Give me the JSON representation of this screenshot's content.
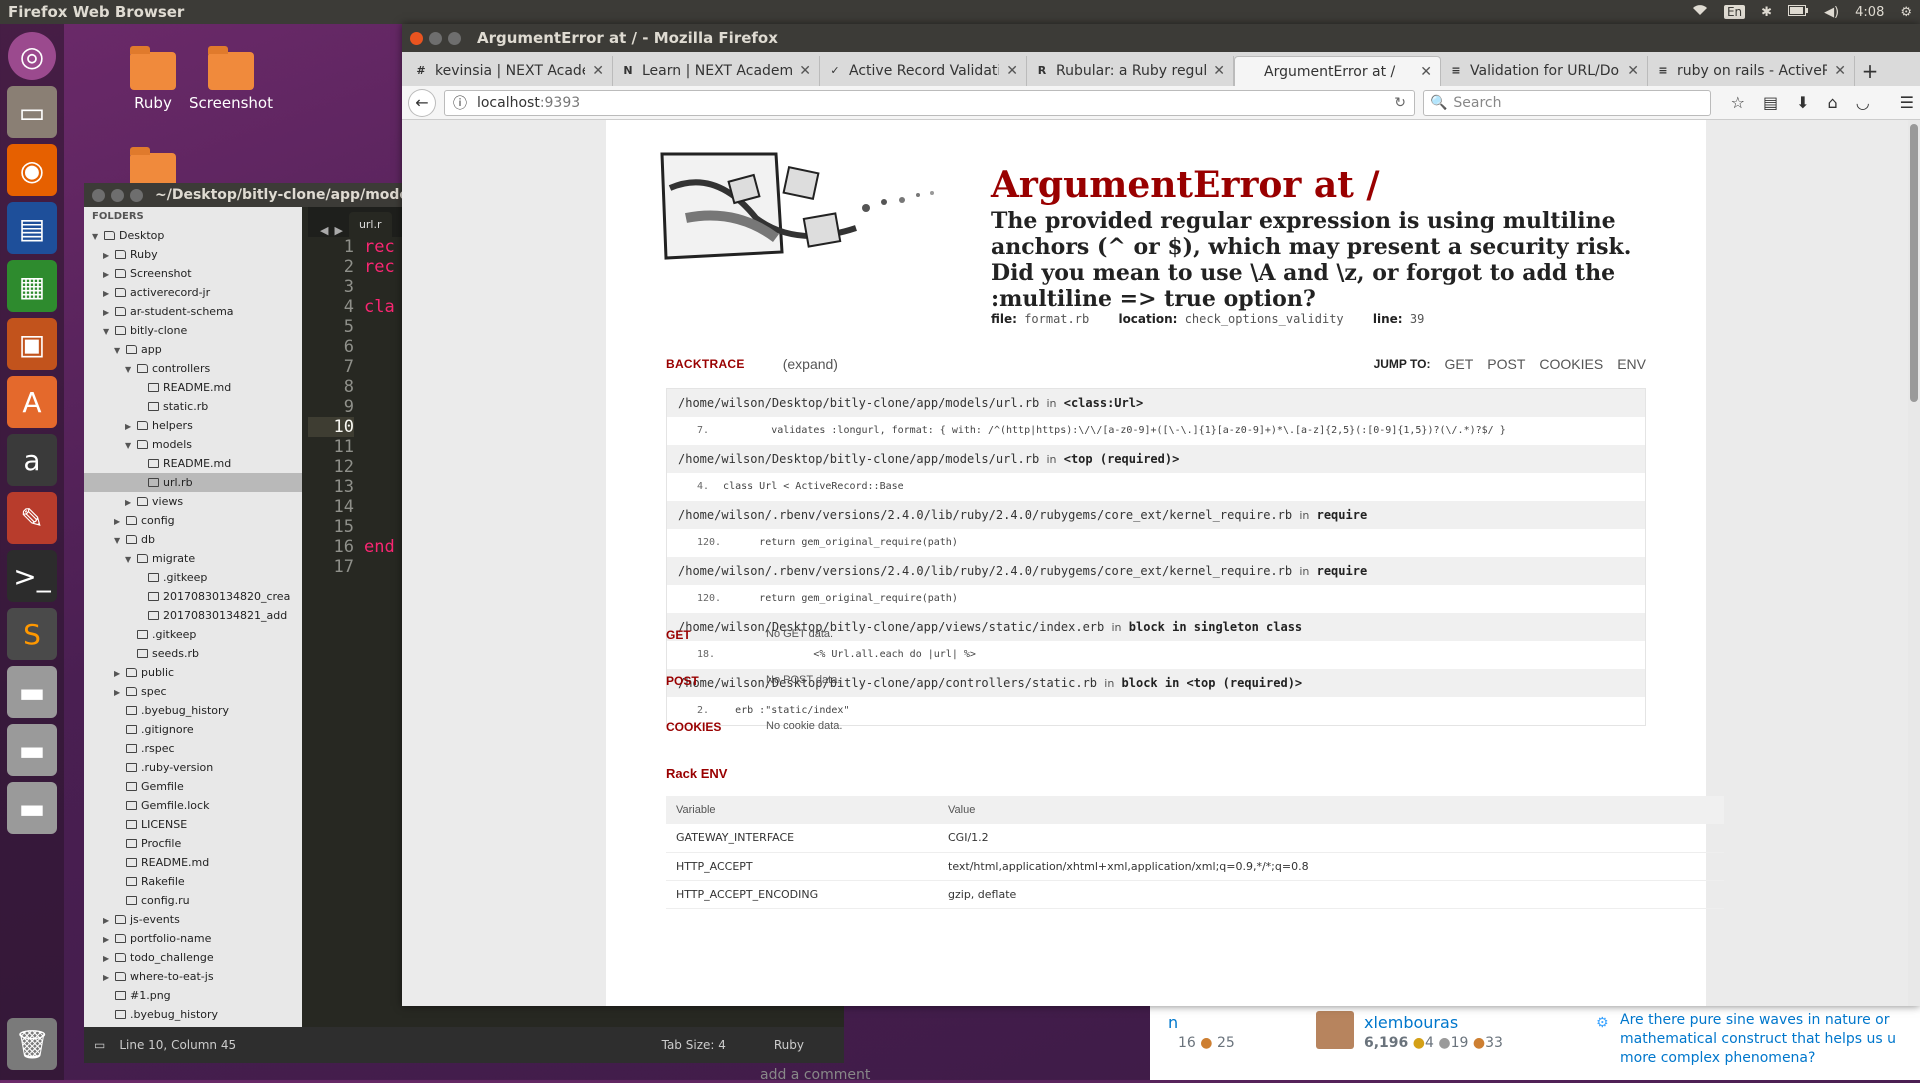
{
  "top_panel": {
    "title": "Firefox Web Browser",
    "keyboard": "En",
    "clock": "4:08"
  },
  "desktop": {
    "icons": [
      {
        "label": "Ruby"
      },
      {
        "label": "Screenshot"
      }
    ]
  },
  "sublime": {
    "title": "~/Desktop/bitly-clone/app/mode",
    "sidebar_header": "FOLDERS",
    "tree": [
      {
        "label": "Desktop",
        "type": "folder",
        "open": true,
        "depth": 0
      },
      {
        "label": "Ruby",
        "type": "folder",
        "open": false,
        "depth": 1
      },
      {
        "label": "Screenshot",
        "type": "folder",
        "open": false,
        "depth": 1
      },
      {
        "label": "activerecord-jr",
        "type": "folder",
        "open": false,
        "depth": 1
      },
      {
        "label": "ar-student-schema",
        "type": "folder",
        "open": false,
        "depth": 1
      },
      {
        "label": "bitly-clone",
        "type": "folder",
        "open": true,
        "depth": 1
      },
      {
        "label": "app",
        "type": "folder",
        "open": true,
        "depth": 2
      },
      {
        "label": "controllers",
        "type": "folder",
        "open": true,
        "depth": 3
      },
      {
        "label": "README.md",
        "type": "file",
        "depth": 4
      },
      {
        "label": "static.rb",
        "type": "file",
        "depth": 4
      },
      {
        "label": "helpers",
        "type": "folder",
        "open": false,
        "depth": 3
      },
      {
        "label": "models",
        "type": "folder",
        "open": true,
        "depth": 3
      },
      {
        "label": "README.md",
        "type": "file",
        "depth": 4
      },
      {
        "label": "url.rb",
        "type": "file",
        "depth": 4,
        "selected": true
      },
      {
        "label": "views",
        "type": "folder",
        "open": false,
        "depth": 3
      },
      {
        "label": "config",
        "type": "folder",
        "open": false,
        "depth": 2
      },
      {
        "label": "db",
        "type": "folder",
        "open": true,
        "depth": 2
      },
      {
        "label": "migrate",
        "type": "folder",
        "open": true,
        "depth": 3
      },
      {
        "label": ".gitkeep",
        "type": "file",
        "depth": 4
      },
      {
        "label": "20170830134820_crea",
        "type": "file",
        "depth": 4
      },
      {
        "label": "20170830134821_add",
        "type": "file",
        "depth": 4
      },
      {
        "label": ".gitkeep",
        "type": "file",
        "depth": 3
      },
      {
        "label": "seeds.rb",
        "type": "file",
        "depth": 3
      },
      {
        "label": "public",
        "type": "folder",
        "open": false,
        "depth": 2
      },
      {
        "label": "spec",
        "type": "folder",
        "open": false,
        "depth": 2
      },
      {
        "label": ".byebug_history",
        "type": "file",
        "depth": 2
      },
      {
        "label": ".gitignore",
        "type": "file",
        "depth": 2
      },
      {
        "label": ".rspec",
        "type": "file",
        "depth": 2
      },
      {
        "label": ".ruby-version",
        "type": "file",
        "depth": 2
      },
      {
        "label": "Gemfile",
        "type": "file",
        "depth": 2
      },
      {
        "label": "Gemfile.lock",
        "type": "file",
        "depth": 2
      },
      {
        "label": "LICENSE",
        "type": "file",
        "depth": 2
      },
      {
        "label": "Procfile",
        "type": "file",
        "depth": 2
      },
      {
        "label": "README.md",
        "type": "file",
        "depth": 2
      },
      {
        "label": "Rakefile",
        "type": "file",
        "depth": 2
      },
      {
        "label": "config.ru",
        "type": "file",
        "depth": 2
      },
      {
        "label": "js-events",
        "type": "folder",
        "open": false,
        "depth": 1
      },
      {
        "label": "portfolio-name",
        "type": "folder",
        "open": false,
        "depth": 1
      },
      {
        "label": "todo_challenge",
        "type": "folder",
        "open": false,
        "depth": 1
      },
      {
        "label": "where-to-eat-js",
        "type": "folder",
        "open": false,
        "depth": 1
      },
      {
        "label": "#1.png",
        "type": "image",
        "depth": 1
      },
      {
        "label": ".byebug_history",
        "type": "file",
        "depth": 1
      }
    ],
    "editor_tab": "url.r",
    "line_numbers": [
      "1",
      "2",
      "3",
      "4",
      "5",
      "6",
      "7",
      "8",
      "9",
      "10",
      "11",
      "12",
      "13",
      "14",
      "15",
      "16",
      "17"
    ],
    "current_line": "10",
    "code_lines": [
      "rec",
      "rec",
      "",
      "cla",
      "",
      "",
      "",
      "",
      "",
      "",
      "",
      "",
      "",
      "",
      "",
      "end",
      ""
    ],
    "status_position": "Line 10, Column 45",
    "status_tab_size": "Tab Size: 4",
    "status_syntax": "Ruby"
  },
  "stackoverflow_peek": {
    "letter": "n",
    "left_stats": "16",
    "left_stats_bronze": "25",
    "user": "xlembouras",
    "rep": "6,196",
    "gold": "4",
    "silver": "19",
    "bronze": "33",
    "related_question": "Are there pure sine waves in nature or mathematical construct that helps us u more complex phenomena?",
    "add_comment": "add a comment"
  },
  "firefox": {
    "window_title": "ArgumentError at / - Mozilla Firefox",
    "tabs": [
      {
        "label": "kevinsia | NEXT Acade",
        "favicon": "#",
        "active": false
      },
      {
        "label": "Learn | NEXT Academy",
        "favicon": "N",
        "active": false
      },
      {
        "label": "Active Record Validati",
        "favicon": "✓",
        "active": false
      },
      {
        "label": "Rubular: a Ruby regul",
        "favicon": "R",
        "active": false
      },
      {
        "label": "ArgumentError at /",
        "favicon": "",
        "active": true
      },
      {
        "label": "Validation for URL/Do",
        "favicon": "≡",
        "active": false
      },
      {
        "label": "ruby on rails - ActiveR",
        "favicon": "≡",
        "active": false
      }
    ],
    "url_host": "localhost",
    "url_port": ":9393",
    "search_placeholder": "Search"
  },
  "error_page": {
    "title": "ArgumentError at /",
    "message": "The provided regular expression is using multiline anchors (^ or $), which may present a security risk. Did you mean to use \\A and \\z, or forgot to add the :multiline => true option?",
    "file_label": "file:",
    "file": "format.rb",
    "location_label": "location:",
    "location": "check_options_validity",
    "line_label": "line:",
    "line": "39",
    "backtrace_label": "BACKTRACE",
    "expand_label": "(expand)",
    "jump_label": "JUMP TO:",
    "jump_links": [
      "GET",
      "POST",
      "COOKIES",
      "ENV"
    ],
    "frames": [
      {
        "file": "/home/wilson/Desktop/bitly-clone/app/models/url.rb",
        "in": "in",
        "context": "<class:Url>",
        "line": "7.",
        "code": "        validates :longurl, format: { with: /^(http|https):\\/\\/[a-z0-9]+([\\-\\.]{1}[a-z0-9]+)*\\.[a-z]{2,5}(:[0-9]{1,5})?(\\/.*)?$/ }"
      },
      {
        "file": "/home/wilson/Desktop/bitly-clone/app/models/url.rb",
        "in": "in",
        "context": "<top (required)>",
        "line": "4.",
        "code": "class Url < ActiveRecord::Base"
      },
      {
        "file": "/home/wilson/.rbenv/versions/2.4.0/lib/ruby/2.4.0/rubygems/core_ext/kernel_require.rb",
        "in": "in",
        "context": "require",
        "line": "120.",
        "code": "    return gem_original_require(path)"
      },
      {
        "file": "/home/wilson/.rbenv/versions/2.4.0/lib/ruby/2.4.0/rubygems/core_ext/kernel_require.rb",
        "in": "in",
        "context": "require",
        "line": "120.",
        "code": "    return gem_original_require(path)"
      },
      {
        "file": "/home/wilson/Desktop/bitly-clone/app/views/static/index.erb",
        "in": "in",
        "context": "block in singleton class",
        "line": "18.",
        "code": "              <% Url.all.each do |url| %>"
      },
      {
        "file": "/home/wilson/Desktop/bitly-clone/app/controllers/static.rb",
        "in": "in",
        "context": "block in <top (required)>",
        "line": "2.",
        "code": "  erb :\"static/index\""
      }
    ],
    "get_label": "GET",
    "get_text": "No GET data.",
    "post_label": "POST",
    "post_text": "No POST data.",
    "cookies_label": "COOKIES",
    "cookies_text": "No cookie data.",
    "rack_env_label": "Rack ENV",
    "env_headers": [
      "Variable",
      "Value"
    ],
    "env_rows": [
      [
        "GATEWAY_INTERFACE",
        "CGI/1.2"
      ],
      [
        "HTTP_ACCEPT",
        "text/html,application/xhtml+xml,application/xml;q=0.9,*/*;q=0.8"
      ],
      [
        "HTTP_ACCEPT_ENCODING",
        "gzip, deflate"
      ]
    ]
  }
}
